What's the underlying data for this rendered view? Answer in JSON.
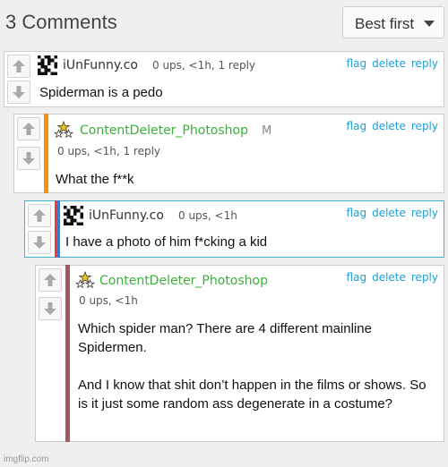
{
  "header": {
    "title": "3 Comments",
    "sort_label": "Best first"
  },
  "colors": {
    "link": "#1a9fd8",
    "username_green": "#3bae3b",
    "username_dark": "#333333",
    "orange_bar": "#f5900e",
    "red_bar": "#ee3a3a",
    "blue_bar": "#3b7dc8",
    "maroon_bar": "#a05a5a"
  },
  "comments": [
    {
      "username": "iUnFunny.co",
      "meta": "0 ups, <1h, 1 reply",
      "actions": [
        "flag",
        "delete",
        "reply"
      ],
      "text": "Spiderman is a pedo",
      "avatar": "pixel-avatar-icon"
    },
    {
      "username": "ContentDeleter_Photoshop",
      "badge": "M",
      "meta": "0 ups, <1h, 1 reply",
      "actions": [
        "flag",
        "delete",
        "reply"
      ],
      "text": "What the f**k",
      "avatar": "stars-avatar-icon"
    },
    {
      "username": "iUnFunny.co",
      "meta": "0 ups, <1h",
      "actions": [
        "flag",
        "delete",
        "reply"
      ],
      "text": "I have a photo of him f*cking a kid",
      "avatar": "pixel-avatar-icon"
    },
    {
      "username": "ContentDeleter_Photoshop",
      "meta": "0 ups, <1h",
      "actions": [
        "flag",
        "delete",
        "reply"
      ],
      "text": "Which spider man? There are 4 different mainline Spidermen.\n\nAnd I know that shit don’t happen in the films or shows. So is it just some random ass degenerate in a costume?",
      "avatar": "stars-avatar-icon"
    }
  ],
  "footer": {
    "watermark": "imgflip.com"
  }
}
